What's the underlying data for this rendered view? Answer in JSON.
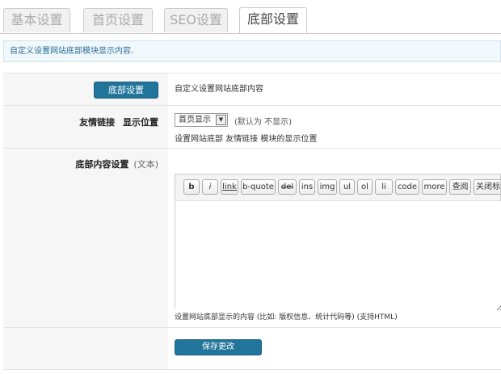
{
  "tabs": [
    {
      "label": "基本设置"
    },
    {
      "label": "首页设置"
    },
    {
      "label": "SEO设置"
    },
    {
      "label": "底部设置"
    }
  ],
  "notice": "自定义设置网站底部模块显示内容.",
  "rows": {
    "footer": {
      "button": "底部设置",
      "desc": "自定义设置网站底部内容"
    },
    "links": {
      "label": "友情链接",
      "label2": "显示位置",
      "selected": "首页显示",
      "default_hint": "(默认为 不显示)",
      "desc": "设置网站底部 友情链接 模块的显示位置"
    },
    "content": {
      "label": "底部内容设置",
      "paren": "(文本)",
      "textarea_value": "",
      "desc": "设置网站底部显示的内容 (比如: 版权信息、统计代码等) (支持HTML)"
    }
  },
  "toolbar": [
    "b",
    "i",
    "link",
    "b-quote",
    "del",
    "ins",
    "img",
    "ul",
    "ol",
    "li",
    "code",
    "more",
    "查阅",
    "关闭标签"
  ],
  "save_button": "保存更改",
  "colors": {
    "accent": "#21759b",
    "notice_bg": "#f0f8fc",
    "label_bg": "#f6f6f6"
  }
}
